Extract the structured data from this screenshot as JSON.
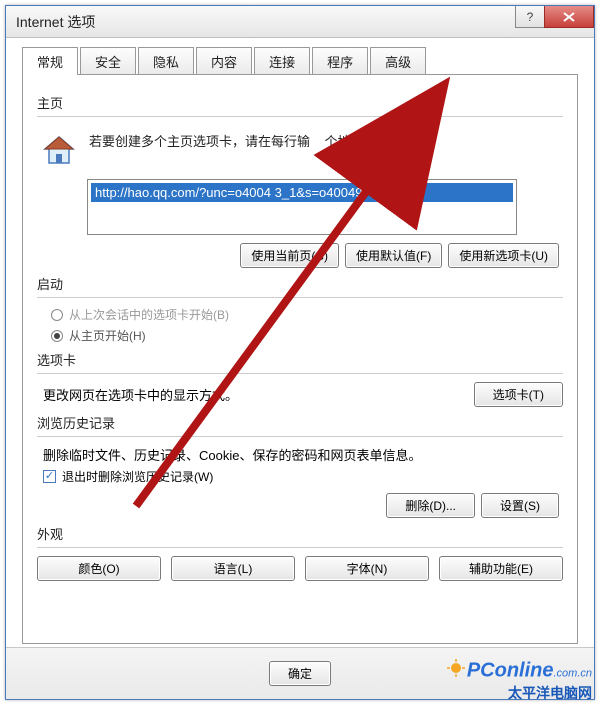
{
  "window": {
    "title": "Internet 选项"
  },
  "tabs": [
    "常规",
    "安全",
    "隐私",
    "内容",
    "连接",
    "程序",
    "高级"
  ],
  "homepage": {
    "group": "主页",
    "desc_prefix": "若要创建多个主页选项卡，请在每行输",
    "desc_suffix": "个地址(R)。",
    "url": "http://hao.qq.com/?unc=o4004  3_1&s=o40049",
    "btn_current": "使用当前页(C)",
    "btn_default": "使用默认值(F)",
    "btn_newtab": "使用新选项卡(U)"
  },
  "startup": {
    "group": "启动",
    "opt_last": "从上次会话中的选项卡开始(B)",
    "opt_home": "从主页开始(H)"
  },
  "tabcard": {
    "group": "选项卡",
    "desc": "更改网页在选项卡中的显示方式。",
    "btn": "选项卡(T)"
  },
  "history": {
    "group": "浏览历史记录",
    "desc": "删除临时文件、历史记录、Cookie、保存的密码和网页表单信息。",
    "chk": "退出时删除浏览历史记录(W)",
    "btn_delete": "删除(D)...",
    "btn_settings": "设置(S)"
  },
  "appearance": {
    "group": "外观",
    "btn_color": "颜色(O)",
    "btn_lang": "语言(L)",
    "btn_font": "字体(N)",
    "btn_access": "辅助功能(E)"
  },
  "footer": {
    "ok": "确定"
  },
  "watermark": {
    "brand": "PConline",
    "suffix": ".com.cn",
    "cn": "太平洋电脑网"
  }
}
